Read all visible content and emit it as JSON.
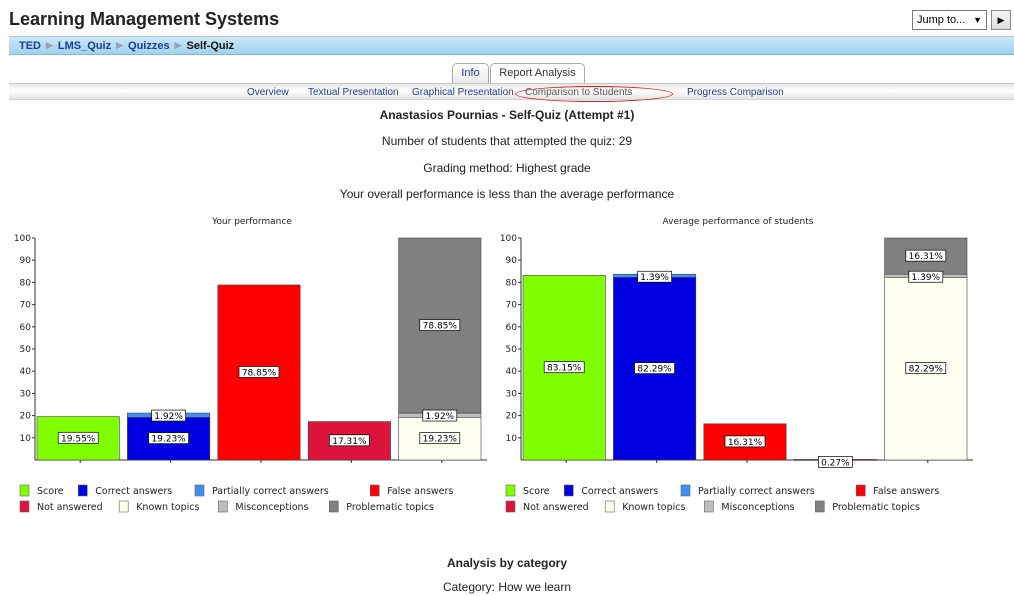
{
  "header": {
    "title": "Learning Management Systems",
    "jump_label": "Jump to...",
    "go_icon": "play-triangle-icon"
  },
  "breadcrumb": {
    "items": [
      "TED",
      "LMS_Quiz",
      "Quizzes"
    ],
    "current": "Self-Quiz"
  },
  "tabs": [
    {
      "label": "Info"
    },
    {
      "label": "Report Analysis"
    }
  ],
  "subtabs": [
    {
      "label": "Overview"
    },
    {
      "label": "Textual Presentation"
    },
    {
      "label": "Graphical Presentation"
    },
    {
      "label": "Comparison to Students",
      "active": true
    },
    {
      "label": "Progress Comparison"
    }
  ],
  "report": {
    "title": "Anastasios Pournias - Self-Quiz (Attempt #1)",
    "students_count": "Number of students that attempted the quiz: 29",
    "grading_method": "Grading method: Highest grade",
    "overall_message": "Your overall performance is less than the average performance"
  },
  "colors": {
    "score": "#80ff00",
    "correct": "#0000e0",
    "partial": "#3d8ff2",
    "false": "#ff0000",
    "not_answered": "#dc143c",
    "known": "#fffff0",
    "misconceptions": "#bdbdbd",
    "problematic": "#808080"
  },
  "chart_data": [
    {
      "type": "bar",
      "title": "Your performance",
      "ylim": [
        0,
        100
      ],
      "yticks": [
        "10",
        "20",
        "30",
        "40",
        "50",
        "60",
        "70",
        "80",
        "90",
        "100"
      ],
      "bars": [
        {
          "segments": [
            {
              "series": "Score",
              "value": 19.55,
              "label": "19.55%"
            }
          ]
        },
        {
          "segments": [
            {
              "series": "Correct answers",
              "value": 19.23,
              "label": "19.23%"
            },
            {
              "series": "Partially correct answers",
              "value": 1.92,
              "label": "1.92%"
            }
          ]
        },
        {
          "segments": [
            {
              "series": "False answers",
              "value": 78.85,
              "label": "78.85%"
            }
          ]
        },
        {
          "segments": [
            {
              "series": "Not answered",
              "value": 17.31,
              "label": "17.31%"
            }
          ]
        },
        {
          "segments": [
            {
              "series": "Known topics",
              "value": 19.23,
              "label": "19.23%"
            },
            {
              "series": "Misconceptions",
              "value": 1.92,
              "label": "1.92%"
            },
            {
              "series": "Problematic topics",
              "value": 78.85,
              "label": "78.85%"
            }
          ]
        }
      ],
      "legend": [
        "Score",
        "Correct answers",
        "Partially correct answers",
        "False answers",
        "Not answered",
        "Known topics",
        "Misconceptions",
        "Problematic topics"
      ]
    },
    {
      "type": "bar",
      "title": "Average performance of students",
      "ylim": [
        0,
        100
      ],
      "yticks": [
        "10",
        "20",
        "30",
        "40",
        "50",
        "60",
        "70",
        "80",
        "90",
        "100"
      ],
      "bars": [
        {
          "segments": [
            {
              "series": "Score",
              "value": 83.15,
              "label": "83.15%"
            }
          ]
        },
        {
          "segments": [
            {
              "series": "Correct answers",
              "value": 82.29,
              "label": "82.29%"
            },
            {
              "series": "Partially correct answers",
              "value": 1.39,
              "label": "1.39%"
            }
          ]
        },
        {
          "segments": [
            {
              "series": "False answers",
              "value": 16.31,
              "label": "16.31%"
            }
          ]
        },
        {
          "segments": [
            {
              "series": "Not answered",
              "value": 0.27,
              "label": "0.27%"
            }
          ]
        },
        {
          "segments": [
            {
              "series": "Known topics",
              "value": 82.29,
              "label": "82.29%"
            },
            {
              "series": "Misconceptions",
              "value": 1.39,
              "label": "1.39%"
            },
            {
              "series": "Problematic topics",
              "value": 16.31,
              "label": "16.31%"
            }
          ]
        }
      ],
      "legend": [
        "Score",
        "Correct answers",
        "Partially correct answers",
        "False answers",
        "Not answered",
        "Known topics",
        "Misconceptions",
        "Problematic topics"
      ]
    }
  ],
  "analysis": {
    "title": "Analysis by category",
    "category": "Category: How we learn"
  }
}
